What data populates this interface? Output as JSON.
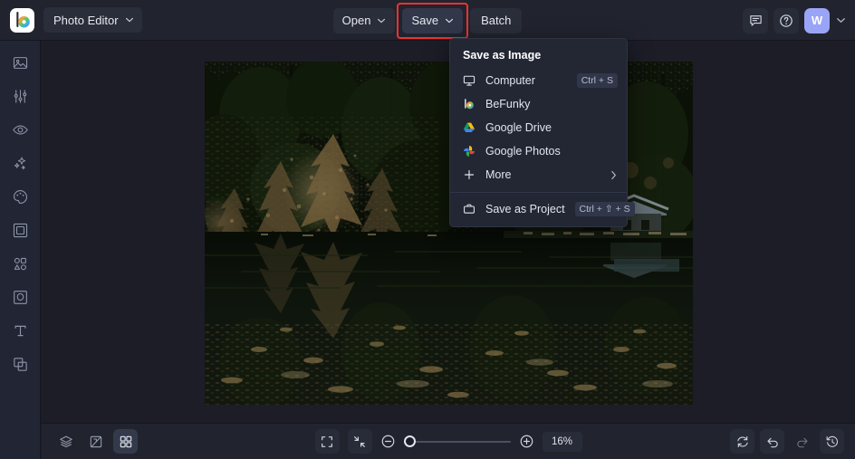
{
  "app": {
    "logo_icon": "befunky-logo-icon",
    "workspace_label": "Photo Editor"
  },
  "header": {
    "open_label": "Open",
    "save_label": "Save",
    "batch_label": "Batch",
    "feedback_icon": "feedback-icon",
    "help_icon": "help-icon",
    "avatar_initial": "W",
    "save_highlight_color": "#ef3232"
  },
  "sidebar": {
    "items": [
      {
        "name": "sidebar-item-edit",
        "icon": "image-edit-icon"
      },
      {
        "name": "sidebar-item-adjust",
        "icon": "sliders-icon"
      },
      {
        "name": "sidebar-item-retouch",
        "icon": "eye-icon"
      },
      {
        "name": "sidebar-item-effects",
        "icon": "sparkle-icon"
      },
      {
        "name": "sidebar-item-artsy",
        "icon": "palette-icon"
      },
      {
        "name": "sidebar-item-frames",
        "icon": "frame-icon"
      },
      {
        "name": "sidebar-item-graphics",
        "icon": "shapes-icon"
      },
      {
        "name": "sidebar-item-textures",
        "icon": "texture-icon"
      },
      {
        "name": "sidebar-item-text",
        "icon": "text-icon"
      },
      {
        "name": "sidebar-item-overlays",
        "icon": "layers-overlay-icon"
      }
    ]
  },
  "save_menu": {
    "title": "Save as Image",
    "items": [
      {
        "label": "Computer",
        "icon": "monitor-icon",
        "shortcut": "Ctrl + S",
        "arrow": false
      },
      {
        "label": "BeFunky",
        "icon": "befunky-icon",
        "shortcut": "",
        "arrow": false
      },
      {
        "label": "Google Drive",
        "icon": "google-drive-icon",
        "shortcut": "",
        "arrow": false
      },
      {
        "label": "Google Photos",
        "icon": "google-photos-icon",
        "shortcut": "",
        "arrow": false
      },
      {
        "label": "More",
        "icon": "plus-icon",
        "shortcut": "",
        "arrow": true
      }
    ],
    "project_item": {
      "label": "Save as Project",
      "icon": "briefcase-icon",
      "shortcut": "Ctrl + ⇧ + S"
    }
  },
  "canvas": {
    "image_alt": "forest-lake-cabin-photo"
  },
  "bottombar": {
    "layers_icon": "layers-icon",
    "compare_icon": "compare-icon",
    "grid_icon": "grid-icon",
    "fit_icon": "fit-screen-icon",
    "actual_icon": "collapse-icon",
    "zoom_out_icon": "zoom-out-icon",
    "zoom_in_icon": "zoom-in-icon",
    "zoom_value": "16%",
    "zoom_slider_percent": 0,
    "reset_icon": "reset-icon",
    "undo_icon": "undo-icon",
    "redo_icon": "redo-icon",
    "history_icon": "history-icon"
  }
}
